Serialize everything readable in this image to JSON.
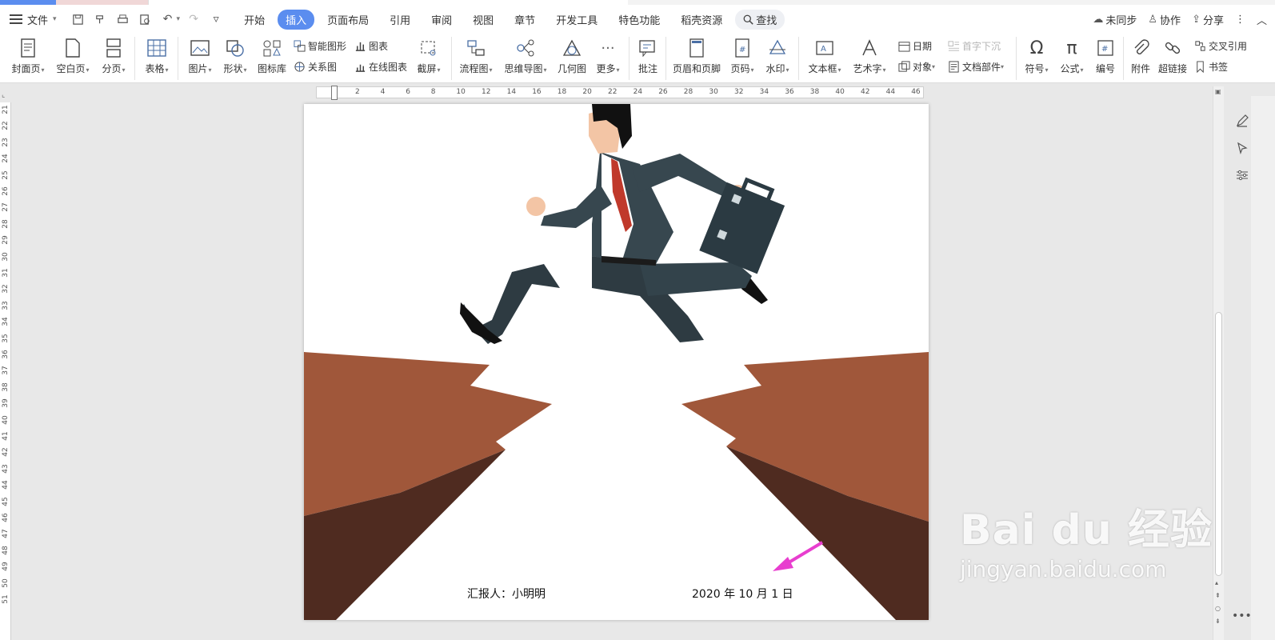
{
  "menubar": {
    "file_label": "文件",
    "tabs": [
      {
        "label": "开始",
        "active": false
      },
      {
        "label": "插入",
        "active": true
      },
      {
        "label": "页面布局",
        "active": false
      },
      {
        "label": "引用",
        "active": false
      },
      {
        "label": "审阅",
        "active": false
      },
      {
        "label": "视图",
        "active": false
      },
      {
        "label": "章节",
        "active": false
      },
      {
        "label": "开发工具",
        "active": false
      },
      {
        "label": "特色功能",
        "active": false
      },
      {
        "label": "稻壳资源",
        "active": false
      }
    ],
    "search_label": "查找",
    "right": {
      "sync": "未同步",
      "collab": "协作",
      "share": "分享"
    },
    "accent_color": "#5b8def"
  },
  "ribbon": {
    "cover": "封面页",
    "blank": "空白页",
    "pagebreak": "分页",
    "table": "表格",
    "picture": "图片",
    "shape": "形状",
    "iconlib": "图标库",
    "smart": "智能图形",
    "chart": "图表",
    "relation": "关系图",
    "onlinechart": "在线图表",
    "screenshot": "截屏",
    "flowchart": "流程图",
    "mindmap": "思维导图",
    "geometry": "几何图",
    "more": "更多",
    "comment": "批注",
    "headerfooter": "页眉和页脚",
    "pagenum": "页码",
    "watermark": "水印",
    "textbox": "文本框",
    "wordart": "艺术字",
    "date": "日期",
    "dropcap": "首字下沉",
    "object": "对象",
    "docpart": "文档部件",
    "symbol": "符号",
    "formula": "公式",
    "numbering": "编号",
    "attach": "附件",
    "hyperlink": "超链接",
    "crossref": "交叉引用",
    "bookmark": "书签"
  },
  "ruler": {
    "h_numbers": [
      "2",
      "4",
      "6",
      "8",
      "10",
      "12",
      "14",
      "16",
      "18",
      "20",
      "22",
      "24",
      "26",
      "28",
      "30",
      "32",
      "34",
      "36",
      "38",
      "40",
      "42",
      "44",
      "46"
    ],
    "v_numbers": [
      "21",
      "22",
      "23",
      "24",
      "25",
      "26",
      "27",
      "28",
      "29",
      "30",
      "31",
      "32",
      "33",
      "34",
      "35",
      "36",
      "37",
      "38",
      "39",
      "40",
      "41",
      "42",
      "43",
      "44",
      "45",
      "46",
      "47",
      "48",
      "49",
      "50",
      "51"
    ]
  },
  "document": {
    "reporter": "汇报人：小明明",
    "date": "2020 年 10 月 1 日",
    "colors": {
      "cliff_light": "#a0573a",
      "cliff_dark": "#4f2b20",
      "suit": "#37474f",
      "tie": "#c0392b",
      "arrow": "#e83ecf"
    }
  },
  "watermark": {
    "brand": "Bai du 经验",
    "url": "jingyan.baidu.com"
  }
}
